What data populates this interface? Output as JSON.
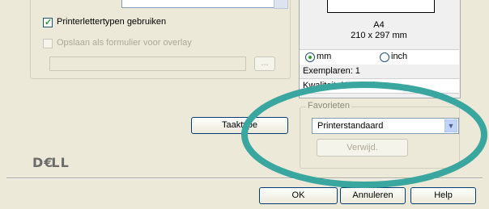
{
  "left_group": {
    "use_printer_fonts": {
      "label": "Printerlettertypen gebruiken",
      "checked": true
    },
    "save_as_overlay": {
      "label": "Opslaan als formulier voor overlay",
      "checked": false,
      "enabled": false
    },
    "overlay_path_value": "",
    "browse_label": "..."
  },
  "preview": {
    "paper_name": "A4",
    "paper_size": "210 x 297 mm",
    "units": {
      "mm_label": "mm",
      "inch_label": "inch",
      "selected": "mm"
    },
    "copies": "Exemplaren: 1",
    "quality": "Kwaliteit: Normaal"
  },
  "favorites": {
    "legend": "Favorieten",
    "selected": "Printerstandaard",
    "delete_label": "Verwijd."
  },
  "buttons": {
    "job_type": "Taaktype",
    "ok": "OK",
    "cancel": "Annuleren",
    "help": "Help"
  },
  "brand": {
    "logo_text": "DELL"
  },
  "colors": {
    "highlight_ellipse": "#3aa6a0"
  }
}
